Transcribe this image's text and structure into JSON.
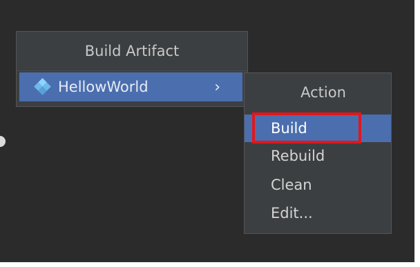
{
  "artifact_popup": {
    "title": "Build Artifact",
    "items": [
      {
        "label": "HellowWorld",
        "icon": "artifact-diamond-icon",
        "submenu_indicator": "›"
      }
    ]
  },
  "action_popup": {
    "title": "Action",
    "items": [
      {
        "label": "Build",
        "selected": true
      },
      {
        "label": "Rebuild",
        "selected": false
      },
      {
        "label": "Clean",
        "selected": false
      },
      {
        "label": "Edit...",
        "selected": false
      }
    ]
  },
  "colors": {
    "background": "#2b2b2b",
    "popup": "#3c3f41",
    "selection": "#4b6eaf",
    "annotation_red": "#e3161b"
  }
}
